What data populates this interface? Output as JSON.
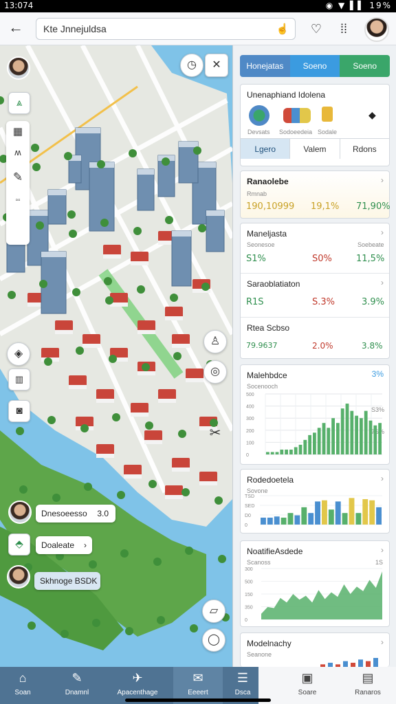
{
  "status_bar": {
    "time": "13:074",
    "indicators": "◉ ▼ ▌▌ 19%"
  },
  "header": {
    "search_text": "Kte Jnnejuldsa",
    "icons": [
      "back-arrow-icon",
      "mic-icon",
      "shield-icon",
      "more-icon",
      "avatar"
    ]
  },
  "map": {
    "labels": {
      "card1": "Dnesoeesso",
      "card1_value": "3.0",
      "card2": "Doaleate",
      "card3": "Skhnoge BSDK"
    },
    "colors": {
      "water": "#7fc3e8",
      "land": "#e6e8e2",
      "park": "#8cc96b",
      "roof_red": "#c9453a",
      "tower": "#6f8fb0"
    }
  },
  "panel": {
    "tabs": [
      {
        "label": "Honejatas",
        "color": "#4f89c6"
      },
      {
        "label": "Soeno",
        "color": "#3b9be0"
      },
      {
        "label": "Soeno",
        "color": "#3aa66a"
      }
    ],
    "overview": {
      "title": "Unenaphiand Idolena",
      "icons": [
        {
          "name": "globe-icon",
          "label": "Devsats"
        },
        {
          "name": "vehicles-icon",
          "label": "Sodoeedeia"
        },
        {
          "name": "document-icon",
          "label": "Sodale"
        }
      ],
      "segments": [
        "Lgero",
        "Valem",
        "Rdons"
      ]
    },
    "metrics": [
      {
        "title": "Ranaolebe",
        "sub": "Rmnab",
        "values": [
          "190,10999",
          "19,1%",
          "71,90%"
        ],
        "colors": [
          "#c9a227",
          "#c9a227",
          "#2f8f4e"
        ]
      },
      {
        "title": "Maneljasta",
        "sub": "Seonesoe",
        "sub2": "Soebeate",
        "values": [
          "S1%",
          "S0%",
          "11,5%"
        ],
        "colors": [
          "#2f8f4e",
          "#c0392b",
          "#2f8f4e"
        ]
      },
      {
        "title": "Saraoblatiaton",
        "sub": "",
        "values": [
          "R1S",
          "S.3%",
          "3.9%"
        ],
        "colors": [
          "#2f8f4e",
          "#c0392b",
          "#2f8f4e"
        ]
      },
      {
        "title": "Rtea Scbso",
        "sub": "",
        "values": [
          "79.9637",
          "2.0%",
          "3.8%"
        ],
        "colors": [
          "#2f8f4e",
          "#c0392b",
          "#2f8f4e"
        ]
      }
    ],
    "charts": [
      {
        "title": "Malehbdce",
        "sub": "Socenooch",
        "side": "3%",
        "side2": "S3%",
        "side3": "7S%"
      },
      {
        "title": "Rodedoetela",
        "sub": "Sovone"
      },
      {
        "title": "NoatifieAsdede",
        "sub": "Scanoss",
        "side": "1S"
      },
      {
        "title": "Modelnachy",
        "sub": "Seanone"
      }
    ]
  },
  "chart_data": [
    {
      "type": "bar",
      "title": "Malehbdce",
      "ytick_labels": [
        "500",
        "400",
        "300",
        "200",
        "100",
        "0"
      ],
      "values": [
        1,
        1,
        1,
        2,
        2,
        2,
        3,
        4,
        6,
        8,
        9,
        11,
        13,
        11,
        15,
        13,
        19,
        21,
        18,
        16,
        15,
        18,
        14,
        12,
        13
      ]
    },
    {
      "type": "bar",
      "title": "Rodedoetela",
      "ytick_labels": [
        "TSD",
        "SED",
        "D0",
        "0"
      ],
      "series": [
        {
          "name": "blue",
          "values": [
            12,
            12,
            14,
            12,
            20,
            16,
            30,
            20,
            40,
            42,
            26,
            40,
            20,
            46,
            20,
            44,
            42,
            30
          ]
        }
      ],
      "colors": [
        "#4a8fd0",
        "#4a8fd0",
        "#4a8fd0",
        "#57b06b",
        "#57b06b",
        "#4a8fd0",
        "#57b06b",
        "#4a8fd0",
        "#4a8fd0",
        "#e2c74a",
        "#57b06b",
        "#4a8fd0",
        "#57b06b",
        "#e2c74a",
        "#57b06b",
        "#e2c74a",
        "#e2c74a",
        "#4a8fd0"
      ]
    },
    {
      "type": "area",
      "title": "NoatifieAsdede",
      "ytick_labels": [
        "300",
        "500",
        "150",
        "350",
        "0"
      ],
      "values": [
        10,
        22,
        20,
        38,
        30,
        45,
        35,
        42,
        30,
        52,
        36,
        48,
        40,
        62,
        45,
        58,
        50,
        70,
        56,
        85
      ]
    },
    {
      "type": "bar",
      "title": "Modelnachy",
      "values": [
        2,
        3,
        2,
        4,
        3,
        5,
        4,
        6
      ]
    }
  ],
  "bottom_nav": [
    {
      "label": "Soan",
      "icon": "home-icon"
    },
    {
      "label": "Dnamnl",
      "icon": "edit-icon"
    },
    {
      "label": "Apacenthage",
      "icon": "send-icon"
    },
    {
      "label": "Eeeert",
      "icon": "compose-icon"
    },
    {
      "label": "Dsca",
      "icon": "menu-icon"
    },
    {
      "label": "Soare",
      "icon": "inbox-icon"
    },
    {
      "label": "Ranaros",
      "icon": "folder-icon"
    }
  ]
}
